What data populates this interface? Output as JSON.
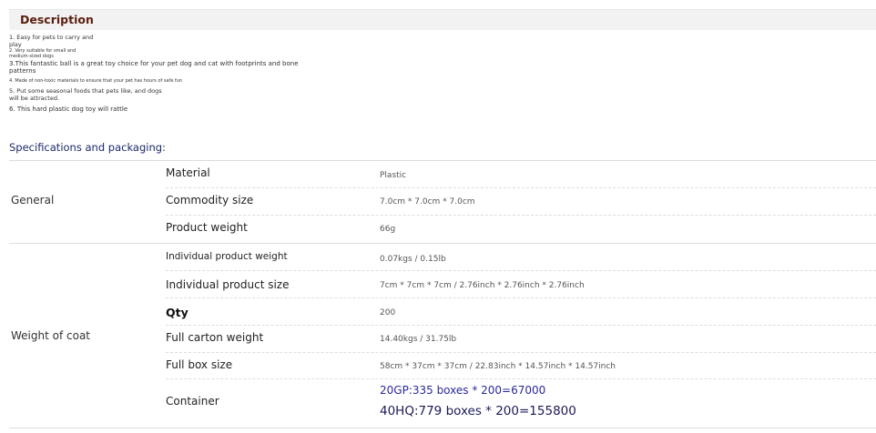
{
  "description": {
    "heading": "Description",
    "lines": [
      "1. Easy for pets to carry and",
      "play",
      "2. Very suitable for small and",
      "medium-sized dogs",
      "3.This fantastic ball is a great toy choice for your pet dog and cat with footprints and bone",
      "patterns",
      "4. Made of non-toxic materials to ensure that your pet has hours of safe fun",
      "5. Put some seasonal foods that pets like, and dogs",
      "will be attracted.",
      "6. This hard plastic dog toy will rattle"
    ]
  },
  "specs": {
    "heading": "Specifications and packaging:",
    "groups": [
      {
        "label": "General",
        "rows": [
          {
            "label": "Material",
            "value": "Plastic"
          },
          {
            "label": "Commodity size",
            "value": "7.0cm * 7.0cm * 7.0cm"
          },
          {
            "label": "Product weight",
            "value": "66g"
          }
        ]
      },
      {
        "label": "Weight of coat",
        "rows": [
          {
            "label": "Individual product weight",
            "value": "0.07kgs / 0.15lb"
          },
          {
            "label": "Individual product size",
            "value": "7cm * 7cm * 7cm / 2.76inch * 2.76inch * 2.76inch"
          },
          {
            "label": "Qty",
            "value": "200"
          },
          {
            "label": "Full carton weight",
            "value": "14.40kgs / 31.75lb"
          },
          {
            "label": "Full box size",
            "value": "58cm * 37cm * 37cm / 22.83inch * 14.57inch * 14.57inch"
          },
          {
            "label": "Container",
            "value_line1": "20GP:335 boxes * 200=67000",
            "value_line2": "40HQ:779 boxes * 200=155800"
          }
        ]
      }
    ]
  }
}
